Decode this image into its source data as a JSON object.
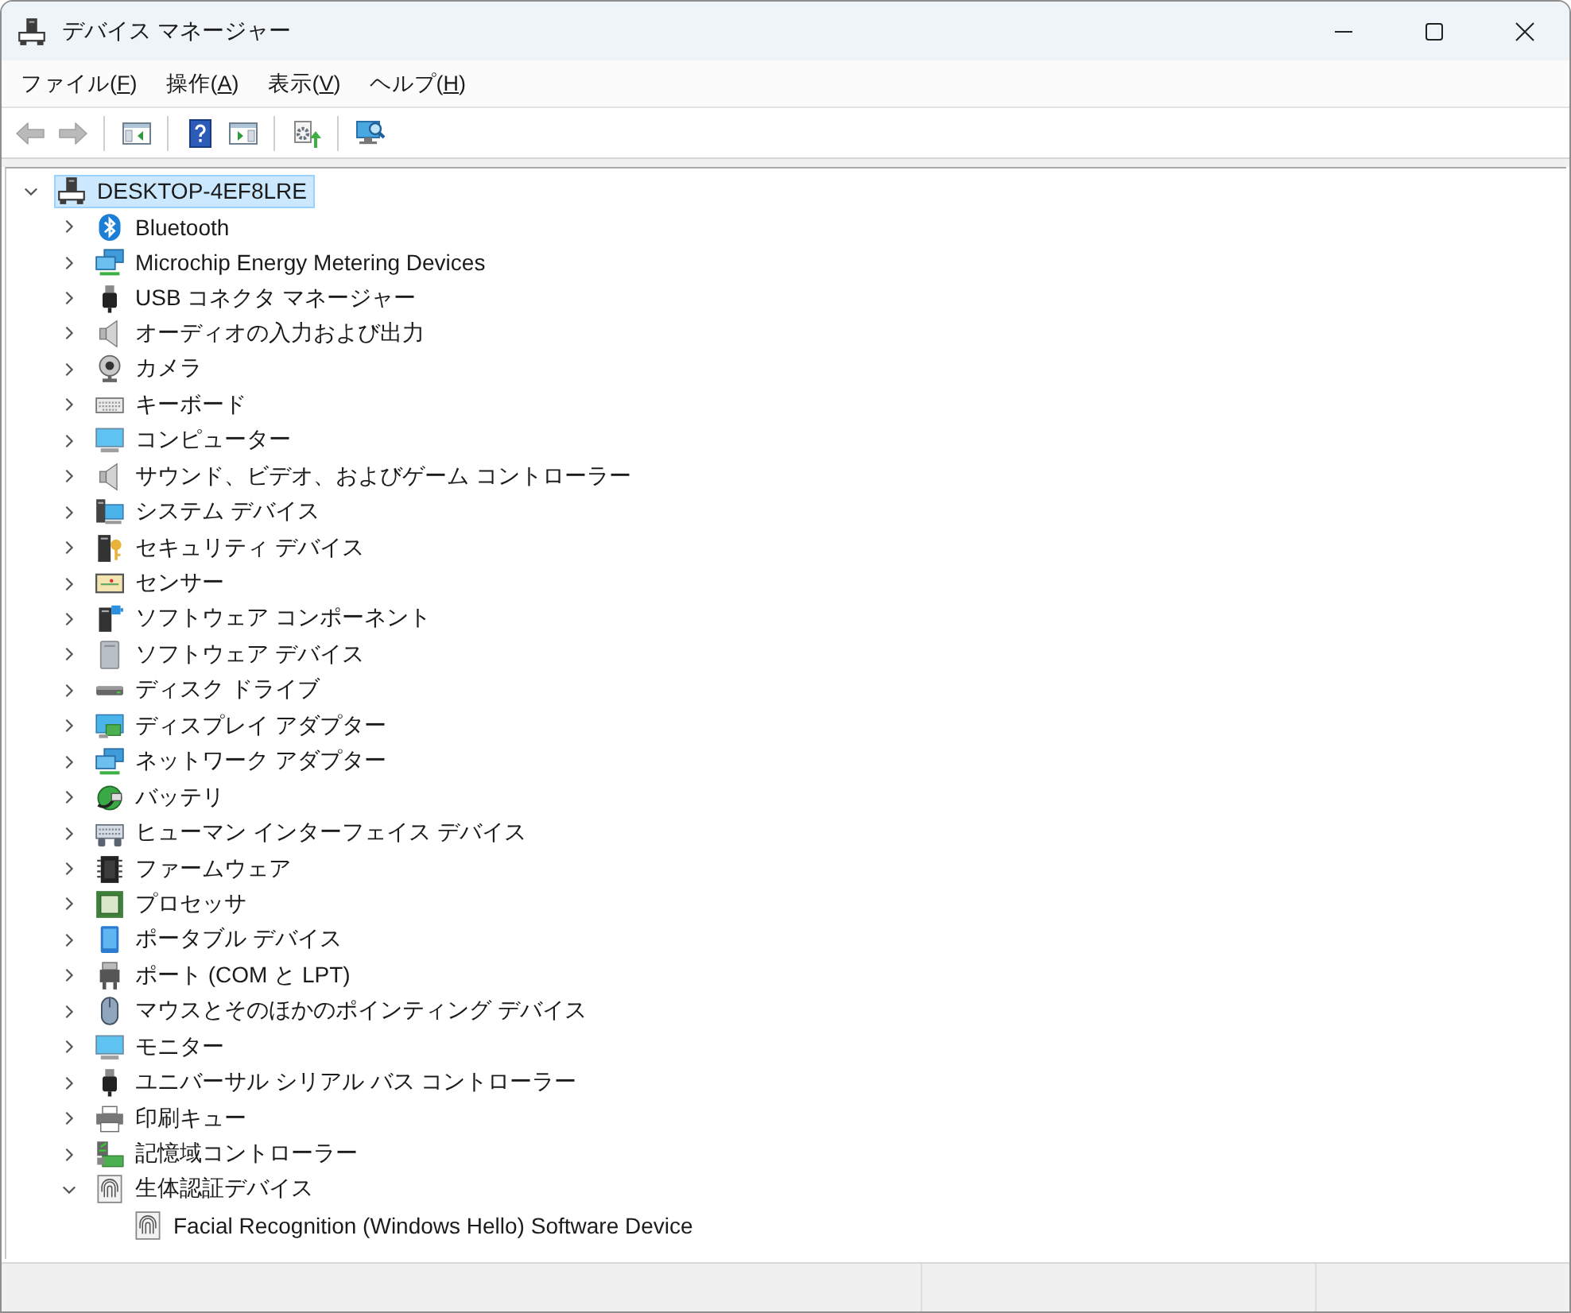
{
  "window": {
    "title": "デバイス マネージャー"
  },
  "menu": [
    {
      "label_start": "ファイル(",
      "access_key": "F",
      "label_end": ")"
    },
    {
      "label_start": "操作(",
      "access_key": "A",
      "label_end": ")"
    },
    {
      "label_start": "表示(",
      "access_key": "V",
      "label_end": ")"
    },
    {
      "label_start": "ヘルプ(",
      "access_key": "H",
      "label_end": ")"
    }
  ],
  "toolbar": [
    {
      "kind": "back",
      "disabled": true
    },
    {
      "kind": "forward",
      "disabled": true
    },
    {
      "kind": "separator"
    },
    {
      "kind": "console-tree",
      "disabled": false
    },
    {
      "kind": "separator"
    },
    {
      "kind": "help",
      "disabled": false
    },
    {
      "kind": "action-pane",
      "disabled": false
    },
    {
      "kind": "separator"
    },
    {
      "kind": "update-driver",
      "disabled": false
    },
    {
      "kind": "separator"
    },
    {
      "kind": "scan",
      "disabled": false
    }
  ],
  "tree": [
    {
      "label": "DESKTOP-4EF8LRE",
      "kind": "computer",
      "expanded": true,
      "selected": true,
      "children": [
        {
          "label": "Bluetooth",
          "kind": "bluetooth",
          "expanded": false,
          "selected": false
        },
        {
          "label": "Microchip Energy Metering Devices",
          "kind": "network",
          "expanded": false,
          "selected": false
        },
        {
          "label": "USB コネクタ マネージャー",
          "kind": "usb",
          "expanded": false,
          "selected": false
        },
        {
          "label": "オーディオの入力および出力",
          "kind": "speaker",
          "expanded": false,
          "selected": false
        },
        {
          "label": "カメラ",
          "kind": "camera",
          "expanded": false,
          "selected": false
        },
        {
          "label": "キーボード",
          "kind": "keyboard",
          "expanded": false,
          "selected": false
        },
        {
          "label": "コンピューター",
          "kind": "monitor",
          "expanded": false,
          "selected": false
        },
        {
          "label": "サウンド、ビデオ、およびゲーム コントローラー",
          "kind": "speaker",
          "expanded": false,
          "selected": false
        },
        {
          "label": "システム デバイス",
          "kind": "system",
          "expanded": false,
          "selected": false
        },
        {
          "label": "セキュリティ デバイス",
          "kind": "security",
          "expanded": false,
          "selected": false
        },
        {
          "label": "センサー",
          "kind": "sensor",
          "expanded": false,
          "selected": false
        },
        {
          "label": "ソフトウェア コンポーネント",
          "kind": "software-component",
          "expanded": false,
          "selected": false
        },
        {
          "label": "ソフトウェア デバイス",
          "kind": "software-device",
          "expanded": false,
          "selected": false
        },
        {
          "label": "ディスク ドライブ",
          "kind": "disk",
          "expanded": false,
          "selected": false
        },
        {
          "label": "ディスプレイ アダプター",
          "kind": "display-adapter",
          "expanded": false,
          "selected": false
        },
        {
          "label": "ネットワーク アダプター",
          "kind": "network",
          "expanded": false,
          "selected": false
        },
        {
          "label": "バッテリ",
          "kind": "battery",
          "expanded": false,
          "selected": false
        },
        {
          "label": "ヒューマン インターフェイス デバイス",
          "kind": "hid",
          "expanded": false,
          "selected": false
        },
        {
          "label": "ファームウェア",
          "kind": "firmware",
          "expanded": false,
          "selected": false
        },
        {
          "label": "プロセッサ",
          "kind": "processor",
          "expanded": false,
          "selected": false
        },
        {
          "label": "ポータブル デバイス",
          "kind": "portable",
          "expanded": false,
          "selected": false
        },
        {
          "label": "ポート (COM と LPT)",
          "kind": "port",
          "expanded": false,
          "selected": false
        },
        {
          "label": "マウスとそのほかのポインティング デバイス",
          "kind": "mouse",
          "expanded": false,
          "selected": false
        },
        {
          "label": "モニター",
          "kind": "monitor",
          "expanded": false,
          "selected": false
        },
        {
          "label": "ユニバーサル シリアル バス コントローラー",
          "kind": "usb",
          "expanded": false,
          "selected": false
        },
        {
          "label": "印刷キュー",
          "kind": "printer",
          "expanded": false,
          "selected": false
        },
        {
          "label": "記憶域コントローラー",
          "kind": "storage",
          "expanded": false,
          "selected": false
        },
        {
          "label": "生体認証デバイス",
          "kind": "biometric",
          "expanded": true,
          "selected": false,
          "children": [
            {
              "label": "Facial Recognition (Windows Hello) Software Device",
              "kind": "biometric",
              "selected": false
            }
          ]
        }
      ]
    }
  ]
}
